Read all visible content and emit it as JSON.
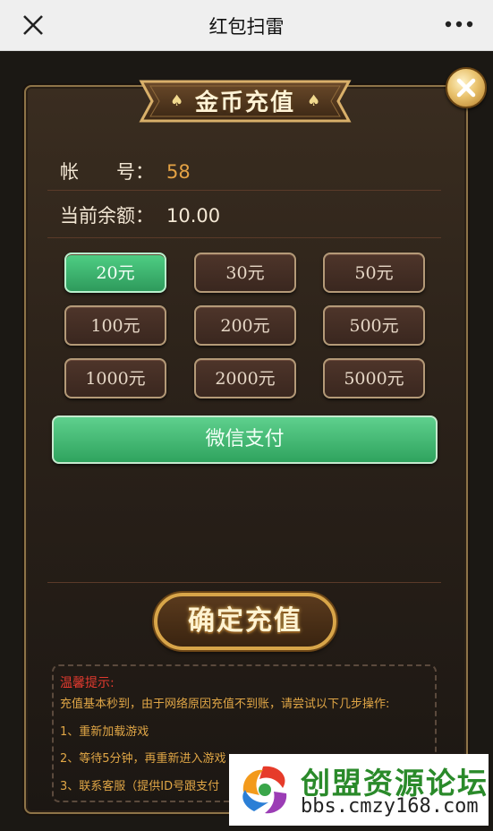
{
  "topbar": {
    "title": "红包扫雷",
    "close_icon": "close-icon",
    "more_icon": "more-dots-icon"
  },
  "dialog": {
    "title": "金币充值",
    "account_label": "帐　　号：",
    "account_value": "58",
    "balance_label": "当前余额：",
    "balance_value": "10.00",
    "amounts": [
      "20元",
      "30元",
      "50元",
      "100元",
      "200元",
      "500元",
      "1000元",
      "2000元",
      "5000元"
    ],
    "selected_amount": "20元",
    "pay_method": "微信支付",
    "confirm_label": "确定充值",
    "tips": {
      "title": "温馨提示:",
      "line1": "充值基本秒到，由于网络原因充值不到账，请尝试以下几步操作:",
      "line2": "1、重新加载游戏",
      "line3": "2、等待5分钟，再重新进入游戏",
      "line4": "3、联系客服（提供ID号跟支付"
    }
  },
  "watermark": {
    "name": "创盟资源论坛",
    "url": "bbs.cmzy168.com"
  },
  "colors": {
    "accent_green": "#3fb873",
    "gold": "#d8a549",
    "value_orange": "#e4a244",
    "tip_red": "#e23a2f"
  }
}
